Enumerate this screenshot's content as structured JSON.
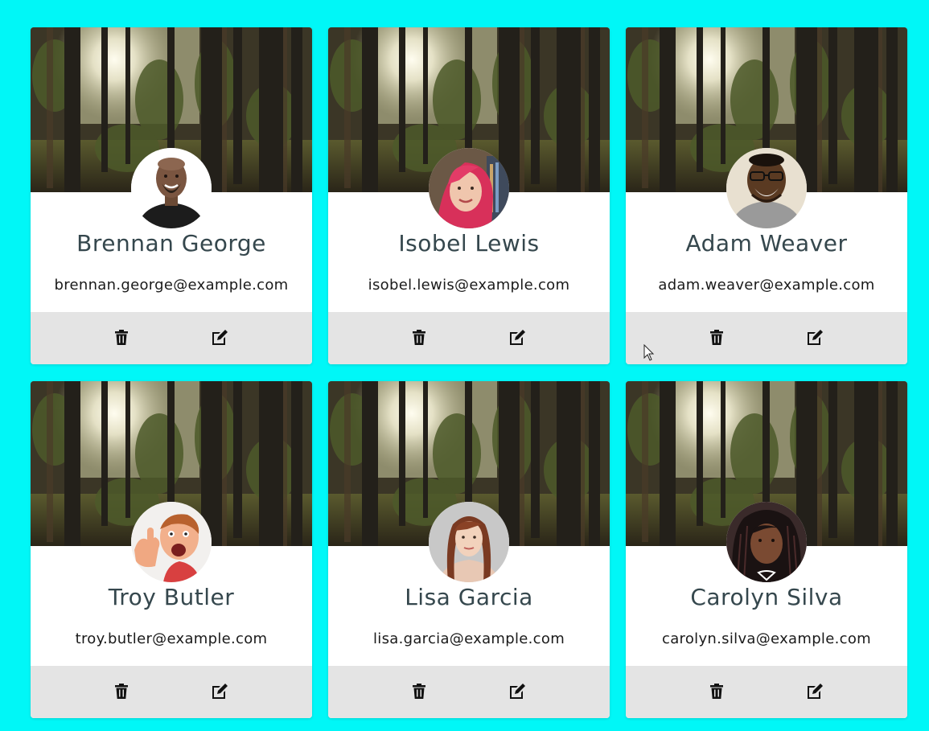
{
  "contacts": [
    {
      "name": "Brennan George",
      "email": "brennan.george@example.com"
    },
    {
      "name": "Isobel Lewis",
      "email": "isobel.lewis@example.com"
    },
    {
      "name": "Adam Weaver",
      "email": "adam.weaver@example.com"
    },
    {
      "name": "Troy Butler",
      "email": "troy.butler@example.com"
    },
    {
      "name": "Lisa Garcia",
      "email": "lisa.garcia@example.com"
    },
    {
      "name": "Carolyn Silva",
      "email": "carolyn.silva@example.com"
    }
  ],
  "icons": {
    "delete": "trash-icon",
    "edit": "edit-icon",
    "cursor": "mouse-pointer-icon"
  },
  "colors": {
    "page_background": "#00f7f7",
    "card_background": "#ffffff",
    "actions_background": "#e4e4e4",
    "name_text": "#35474d",
    "email_text": "#1a1a1a"
  }
}
